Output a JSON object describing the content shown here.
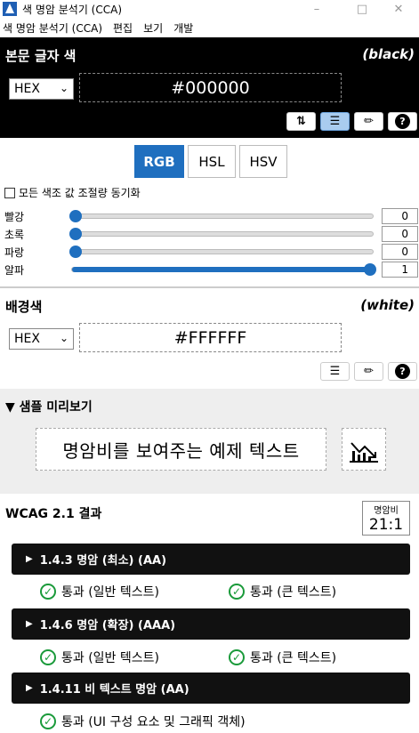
{
  "window": {
    "title": "색 명암 분석기 (CCA)"
  },
  "menu": [
    "색 명암 분석기 (CCA)",
    "편집",
    "보기",
    "개발"
  ],
  "foreground": {
    "heading": "본문 글자 색",
    "color_name": "(black)",
    "format": "HEX",
    "value": "#000000",
    "color": "#000000"
  },
  "tools": {
    "swap_icon": "swap-icon",
    "sliders_icon": "sliders-icon",
    "picker_icon": "eyedropper-icon",
    "help": "?"
  },
  "color_model_tabs": [
    {
      "label": "RGB",
      "active": true
    },
    {
      "label": "HSL",
      "active": false
    },
    {
      "label": "HSV",
      "active": false
    }
  ],
  "sync_label": "모든 색조 값 조절량 동기화",
  "sliders": [
    {
      "label": "빨강",
      "value": "0",
      "level": 0
    },
    {
      "label": "초록",
      "value": "0",
      "level": 0
    },
    {
      "label": "파랑",
      "value": "0",
      "level": 0
    },
    {
      "label": "알파",
      "value": "1",
      "level": 1
    }
  ],
  "background": {
    "heading": "배경색",
    "color_name": "(white)",
    "format": "HEX",
    "value": "#FFFFFF",
    "color": "#FFFFFF"
  },
  "preview": {
    "heading": "▼ 샘플 미리보기",
    "sample_text": "명암비를 보여주는 예제 텍스트"
  },
  "wcag": {
    "title": "WCAG 2.1 결과",
    "ratio_label": "명암비",
    "ratio_value": "21:1",
    "criteria": [
      {
        "label": "1.4.3 명암 (최소) (AA)",
        "results": [
          "통과 (일반 텍스트)",
          "통과 (큰 텍스트)"
        ]
      },
      {
        "label": "1.4.6 명암 (확장) (AAA)",
        "results": [
          "통과 (일반 텍스트)",
          "통과 (큰 텍스트)"
        ]
      },
      {
        "label": "1.4.11 비 텍스트 명암 (AA)",
        "results": [
          "통과 (UI 구성 요소 및 그래픽 객체)"
        ]
      }
    ]
  },
  "colors": {
    "accent": "#1f6fbf",
    "pass": "#1a9a3a"
  }
}
